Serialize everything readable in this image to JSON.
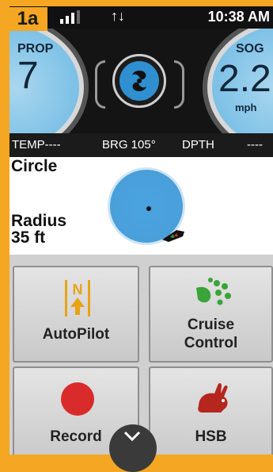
{
  "figure_label": "1a",
  "status_bar": {
    "time": "10:38 AM",
    "data_icon": "data-transfer-icon"
  },
  "header": {
    "prop_label": "PROP",
    "prop_value": "7",
    "sog_label": "SOG",
    "sog_value": "2.2",
    "sog_unit": "mph",
    "center_icon": "propeller-icon"
  },
  "info_strip": {
    "temp": "TEMP----",
    "brg": "BRG 105°",
    "dpth": "DPTH",
    "dpth_value": "----"
  },
  "circle_panel": {
    "mode_title": "Circle",
    "radius_label": "Radius",
    "radius_value": "35 ft"
  },
  "tiles": [
    {
      "label": "AutoPilot",
      "icon": "autopilot-icon"
    },
    {
      "label_line1": "Cruise",
      "label_line2": "Control",
      "icon": "cruise-control-icon"
    },
    {
      "label": "Record",
      "icon": "record-icon"
    },
    {
      "label": "HSB",
      "icon": "rabbit-icon"
    }
  ],
  "colors": {
    "frame": "#f5a623",
    "gauge": "#7cc0e6",
    "prop_button": "#2f8fd0",
    "record": "#d92b2b",
    "cruise": "#3aa33a",
    "hsb": "#b5261e",
    "autopilot": "#e8a317"
  }
}
